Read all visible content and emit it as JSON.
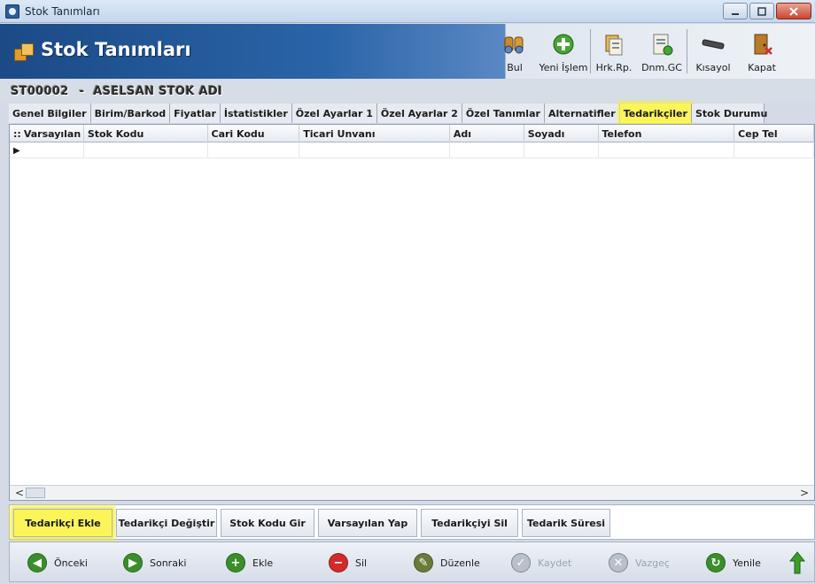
{
  "window": {
    "title": "Stok Tanımları"
  },
  "banner": {
    "title": "Stok Tanımları"
  },
  "toolbar": [
    {
      "label": "Bul",
      "icon": "binoculars-icon"
    },
    {
      "label": "Yeni İşlem",
      "icon": "plus-circle-icon"
    },
    {
      "label": "Hrk.Rp.",
      "icon": "report-icon"
    },
    {
      "label": "Dnm.GC",
      "icon": "clipboard-icon"
    },
    {
      "label": "Kısayol",
      "icon": "shortcut-icon"
    },
    {
      "label": "Kapat",
      "icon": "exit-door-icon"
    }
  ],
  "stock": {
    "code": "ST00002",
    "separator": "-",
    "name": "ASELSAN STOK ADI"
  },
  "tabs": [
    "Genel Bilgiler",
    "Birim/Barkod",
    "Fiyatlar",
    "İstatistikler",
    "Özel Ayarlar 1",
    "Özel Ayarlar 2",
    "Özel Tanımlar",
    "Alternatifler",
    "Tedarikçiler",
    "Stok Durumu"
  ],
  "active_tab": "Tedarikçiler",
  "grid": {
    "corner": "::",
    "columns": [
      "Varsayılan",
      "Stok Kodu",
      "Cari Kodu",
      "Ticari Unvanı",
      "Adı",
      "Soyadı",
      "Telefon",
      "Cep Tel"
    ],
    "row_marker": "▶",
    "scroll_left": "<",
    "scroll_right": ">"
  },
  "actions": [
    "Tedarikçi Ekle",
    "Tedarikçi Değiştir",
    "Stok Kodu Gir",
    "Varsayılan Yap",
    "Tedarikçiyi Sil",
    "Tedarik Süresi"
  ],
  "nav": [
    {
      "label": "Önceki",
      "icon": "arrow-left-icon",
      "color": "#3a8f2a",
      "enabled": true
    },
    {
      "label": "Sonraki",
      "icon": "arrow-right-icon",
      "color": "#3a8f2a",
      "enabled": true
    },
    {
      "label": "Ekle",
      "icon": "plus-icon",
      "color": "#3a8f2a",
      "enabled": true
    },
    {
      "label": "Sil",
      "icon": "minus-icon",
      "color": "#d42a2a",
      "enabled": true
    },
    {
      "label": "Düzenle",
      "icon": "edit-icon",
      "color": "#6b7b3a",
      "enabled": true
    },
    {
      "label": "Kaydet",
      "icon": "check-icon",
      "color": "#b9c0c9",
      "enabled": false
    },
    {
      "label": "Vazgeç",
      "icon": "cancel-icon",
      "color": "#b9c0c9",
      "enabled": false
    },
    {
      "label": "Yenile",
      "icon": "refresh-icon",
      "color": "#3a8f2a",
      "enabled": true
    }
  ],
  "colors": {
    "highlight": "#fbf55a",
    "banner": "#1b4a86"
  }
}
